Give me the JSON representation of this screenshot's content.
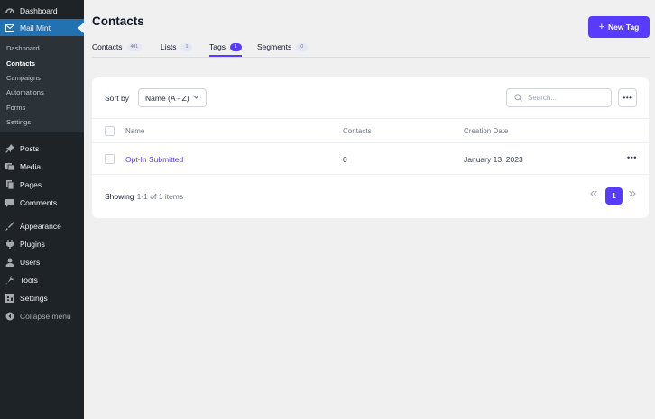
{
  "sidebar": {
    "top_items": [
      {
        "label": "Dashboard",
        "icon": "dashboard-icon"
      },
      {
        "label": "Mail Mint",
        "icon": "envelope-icon"
      }
    ],
    "submenu": [
      "Dashboard",
      "Contacts",
      "Campaigns",
      "Automations",
      "Forms",
      "Settings"
    ],
    "submenu_current": "Contacts",
    "items": [
      {
        "label": "Posts",
        "icon": "pushpin-icon"
      },
      {
        "label": "Media",
        "icon": "media-icon"
      },
      {
        "label": "Pages",
        "icon": "pages-icon"
      },
      {
        "label": "Comments",
        "icon": "comments-icon"
      },
      {
        "label": "Appearance",
        "icon": "brush-icon"
      },
      {
        "label": "Plugins",
        "icon": "plugin-icon"
      },
      {
        "label": "Users",
        "icon": "user-icon"
      },
      {
        "label": "Tools",
        "icon": "wrench-icon"
      },
      {
        "label": "Settings",
        "icon": "settings-icon"
      },
      {
        "label": "Collapse menu",
        "icon": "collapse-icon"
      }
    ],
    "colors": {
      "bg": "#1d2327",
      "submenu_bg": "#2c3338",
      "active": "#2271b1"
    }
  },
  "header": {
    "title": "Contacts",
    "new_button": "New Tag"
  },
  "tabs": [
    {
      "label": "Contacts",
      "count": "401"
    },
    {
      "label": "Lists",
      "count": "1"
    },
    {
      "label": "Tags",
      "count": "1"
    },
    {
      "label": "Segments",
      "count": "0"
    }
  ],
  "active_tab": "Tags",
  "toolbar": {
    "sort_label": "Sort by",
    "sort_value": "Name (A - Z)",
    "search_placeholder": "Search..."
  },
  "table": {
    "columns": [
      "Name",
      "Contacts",
      "Creation Date"
    ],
    "rows": [
      {
        "name": "Opt-In Submitted",
        "contacts": "0",
        "date": "January 13, 2023"
      }
    ]
  },
  "footer": {
    "showing_label": "Showing",
    "range": "1-1 of 1 items",
    "current_page": "1"
  },
  "accent_color": "#573bff"
}
